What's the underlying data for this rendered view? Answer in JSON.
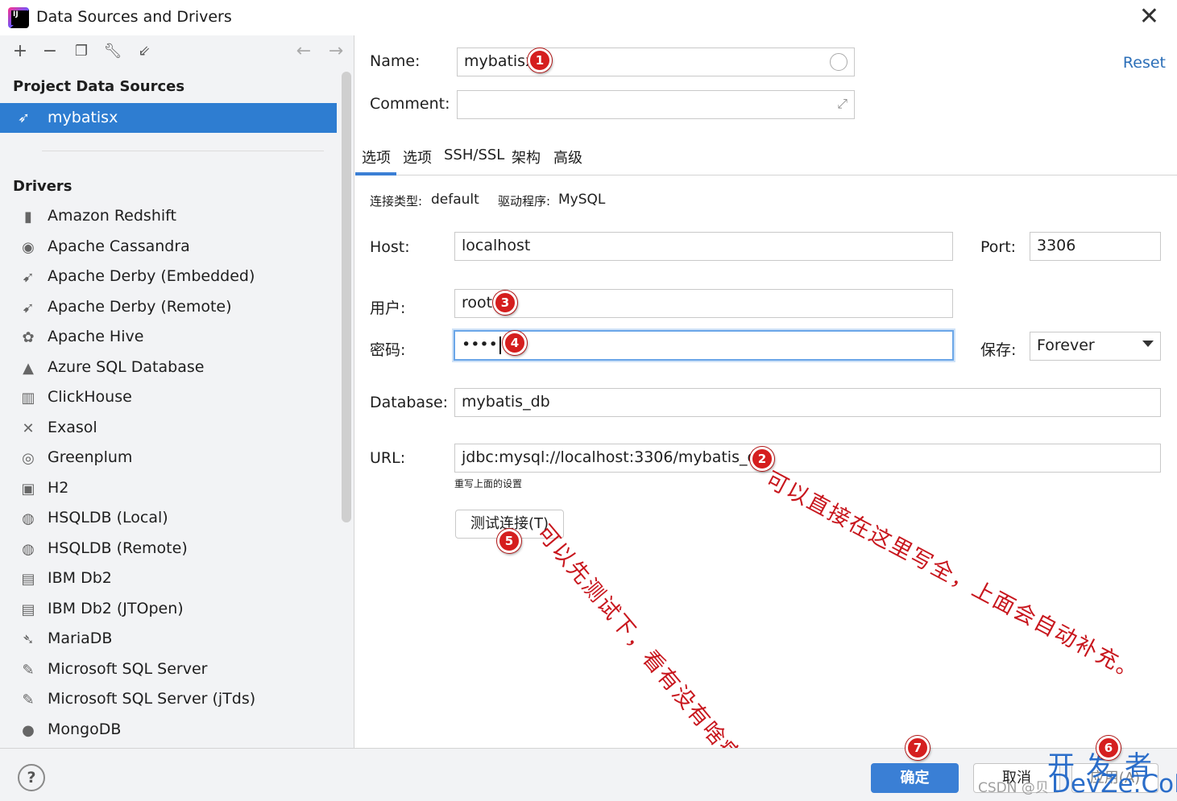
{
  "window": {
    "title": "Data Sources and Drivers"
  },
  "left": {
    "section_project": "Project Data Sources",
    "selected_datasource": "mybatisx",
    "section_drivers": "Drivers",
    "drivers": [
      {
        "label": "Amazon Redshift",
        "icon": "redshift-icon"
      },
      {
        "label": "Apache Cassandra",
        "icon": "cassandra-icon"
      },
      {
        "label": "Apache Derby (Embedded)",
        "icon": "derby-icon"
      },
      {
        "label": "Apache Derby (Remote)",
        "icon": "derby-icon"
      },
      {
        "label": "Apache Hive",
        "icon": "hive-icon"
      },
      {
        "label": "Azure SQL Database",
        "icon": "azure-icon"
      },
      {
        "label": "ClickHouse",
        "icon": "clickhouse-icon"
      },
      {
        "label": "Exasol",
        "icon": "exasol-icon"
      },
      {
        "label": "Greenplum",
        "icon": "greenplum-icon"
      },
      {
        "label": "H2",
        "icon": "h2-icon"
      },
      {
        "label": "HSQLDB (Local)",
        "icon": "hsqldb-icon"
      },
      {
        "label": "HSQLDB (Remote)",
        "icon": "hsqldb-icon"
      },
      {
        "label": "IBM Db2",
        "icon": "ibm-icon"
      },
      {
        "label": "IBM Db2 (JTOpen)",
        "icon": "ibm-icon"
      },
      {
        "label": "MariaDB",
        "icon": "mariadb-icon"
      },
      {
        "label": "Microsoft SQL Server",
        "icon": "mssql-icon"
      },
      {
        "label": "Microsoft SQL Server (jTds)",
        "icon": "mssql-icon"
      },
      {
        "label": "MongoDB",
        "icon": "mongodb-icon"
      }
    ]
  },
  "form": {
    "name_label": "Name:",
    "name_value": "mybatisx",
    "comment_label": "Comment:",
    "reset": "Reset",
    "tabs": [
      "选项",
      "选项",
      "SSH/SSL",
      "架构",
      "高级"
    ],
    "conn_type_label": "连接类型:",
    "conn_type_value": "default",
    "driver_label": "驱动程序:",
    "driver_value": "MySQL",
    "host_label": "Host:",
    "host_value": "localhost",
    "port_label": "Port:",
    "port_value": "3306",
    "user_label": "用户:",
    "user_value": "root",
    "password_label": "密码:",
    "password_value": "••••",
    "save_label": "保存:",
    "save_value": "Forever",
    "database_label": "Database:",
    "database_value": "mybatis_db",
    "url_label": "URL:",
    "url_value": "jdbc:mysql://localhost:3306/mybatis_db",
    "url_hint": "重写上面的设置",
    "test_button": "测试连接(T)"
  },
  "annotations": {
    "url_note": "可以直接在这里写全，上面会自动补充。",
    "test_note": "可以先测试下，看有没有啥病。"
  },
  "badges": [
    "1",
    "2",
    "3",
    "4",
    "5",
    "6",
    "7"
  ],
  "bottom": {
    "help": "?",
    "ok": "确定",
    "cancel": "取消",
    "apply": "应用(A)",
    "watermark_cn": "开发者",
    "watermark_en": "DevZe.CoM",
    "watermark_csdn": "CSDN @贝"
  },
  "colors": {
    "accent": "#2e7dd1",
    "annotation": "#c8161d",
    "badge": "#d51e1e"
  }
}
